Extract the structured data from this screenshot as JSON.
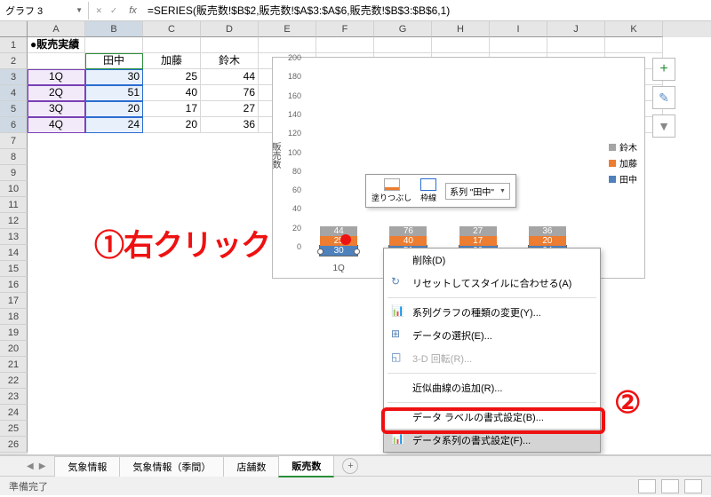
{
  "namebox": "グラフ 3",
  "fx": "fx",
  "formula": "=SERIES(販売数!$B$2,販売数!$A$3:$A$6,販売数!$B$3:$B$6,1)",
  "cols": [
    "A",
    "B",
    "C",
    "D",
    "E",
    "F",
    "G",
    "H",
    "I",
    "J",
    "K"
  ],
  "rows": [
    "1",
    "2",
    "3",
    "4",
    "5",
    "6",
    "7",
    "8",
    "9",
    "10",
    "11",
    "12",
    "13",
    "14",
    "15",
    "16",
    "17",
    "18",
    "19",
    "20",
    "21",
    "22",
    "23",
    "24",
    "25",
    "26"
  ],
  "table": {
    "title": "●販売実績",
    "headers": [
      "",
      "田中",
      "加藤",
      "鈴木"
    ],
    "rows": [
      [
        "1Q",
        "30",
        "25",
        "44"
      ],
      [
        "2Q",
        "51",
        "40",
        "76"
      ],
      [
        "3Q",
        "20",
        "17",
        "27"
      ],
      [
        "4Q",
        "24",
        "20",
        "36"
      ]
    ]
  },
  "chart_data": {
    "type": "bar",
    "stacked": true,
    "ylabel": "販売数",
    "categories": [
      "1Q",
      "2Q",
      "3Q",
      "4Q"
    ],
    "series": [
      {
        "name": "田中",
        "values": [
          30,
          51,
          20,
          24
        ],
        "color": "#4f81bd"
      },
      {
        "name": "加藤",
        "values": [
          25,
          40,
          17,
          20
        ],
        "color": "#ed7d31"
      },
      {
        "name": "鈴木",
        "values": [
          44,
          76,
          27,
          36
        ],
        "color": "#a5a5a5"
      }
    ],
    "legend_order": [
      "鈴木",
      "加藤",
      "田中"
    ],
    "yticks": [
      "0",
      "20",
      "40",
      "60",
      "80",
      "100",
      "120",
      "140",
      "160",
      "180",
      "200"
    ],
    "ylim": [
      0,
      200
    ]
  },
  "chart_buttons": {
    "plus": "+",
    "brush": "✎",
    "funnel": "▾"
  },
  "mini_toolbar": {
    "fill_label": "塗りつぶし",
    "outline_label": "枠線",
    "combo": "系列 \"田中\""
  },
  "context_menu": {
    "delete": "削除(D)",
    "reset": "リセットしてスタイルに合わせる(A)",
    "change_type": "系列グラフの種類の変更(Y)...",
    "select_data": "データの選択(E)...",
    "rotate3d": "3-D 回転(R)...",
    "trendline": "近似曲線の追加(R)...",
    "datalabel": "データ ラベルの書式設定(B)...",
    "format_series": "データ系列の書式設定(F)..."
  },
  "annotations": {
    "step1": "①右クリック",
    "step2": "②"
  },
  "sheet_tabs": [
    "気象情報",
    "気象情報（季間）",
    "店舗数",
    "販売数"
  ],
  "active_tab": 3,
  "status_text": "準備完了"
}
